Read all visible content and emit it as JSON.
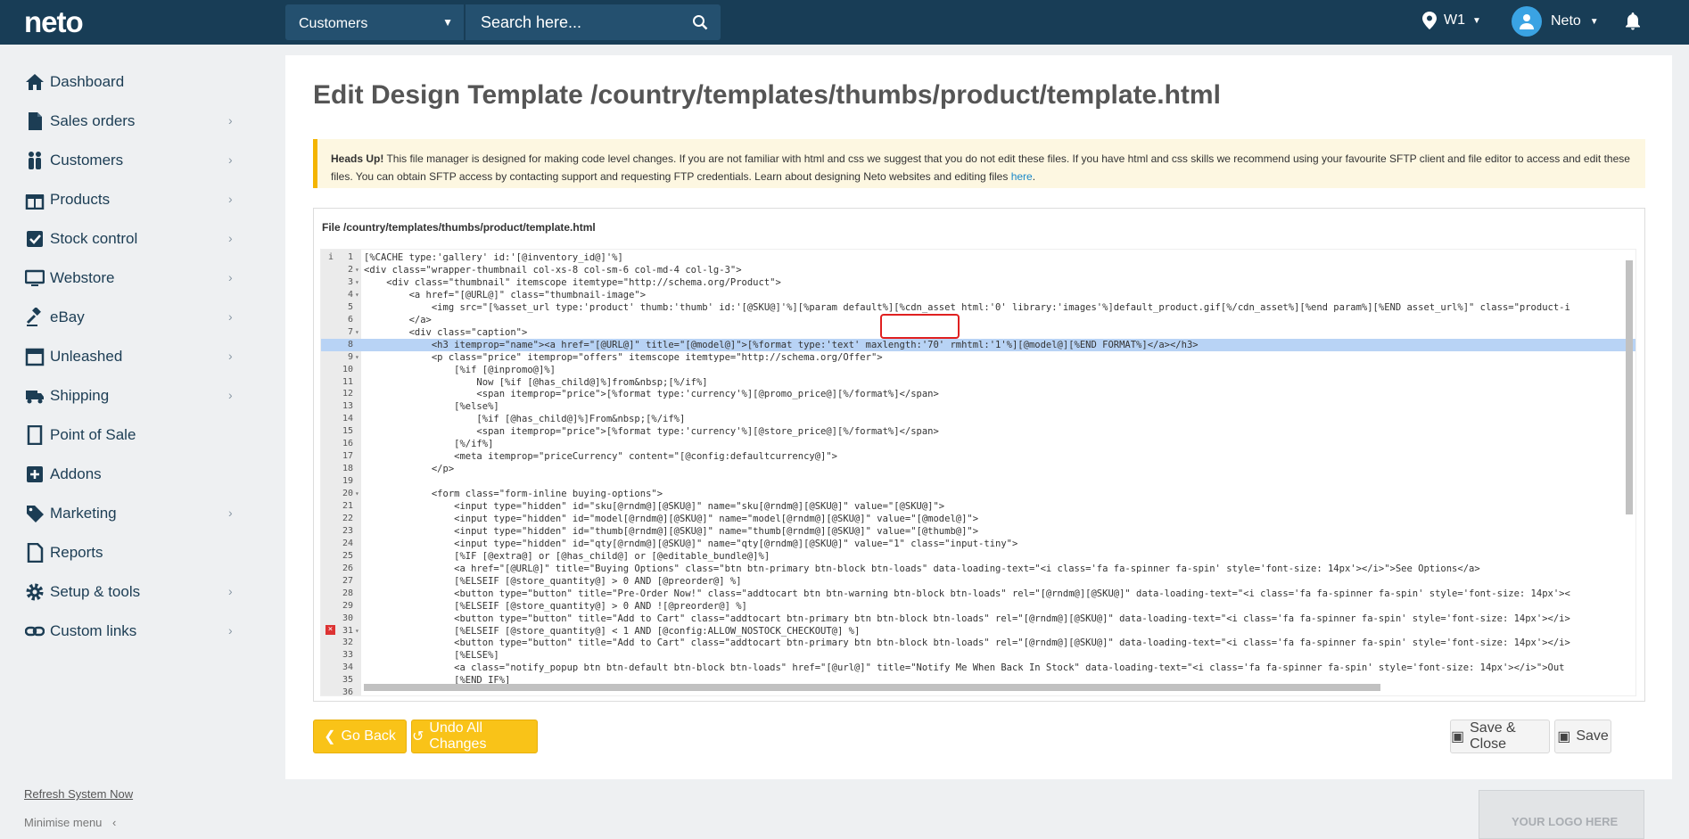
{
  "topbar": {
    "logo": "neto",
    "scope": "Customers",
    "search_placeholder": "Search here...",
    "location": "W1",
    "user": "Neto"
  },
  "sidebar": {
    "items": [
      {
        "label": "Dashboard",
        "icon": "home-icon"
      },
      {
        "label": "Sales orders",
        "icon": "document-icon"
      },
      {
        "label": "Customers",
        "icon": "people-icon"
      },
      {
        "label": "Products",
        "icon": "gift-icon"
      },
      {
        "label": "Stock control",
        "icon": "checkbox-icon"
      },
      {
        "label": "Webstore",
        "icon": "monitor-icon"
      },
      {
        "label": "eBay",
        "icon": "gavel-icon"
      },
      {
        "label": "Unleashed",
        "icon": "box-icon"
      },
      {
        "label": "Shipping",
        "icon": "truck-icon"
      },
      {
        "label": "Point of Sale",
        "icon": "pos-icon"
      },
      {
        "label": "Addons",
        "icon": "plus-box-icon"
      },
      {
        "label": "Marketing",
        "icon": "tag-icon"
      },
      {
        "label": "Reports",
        "icon": "report-icon"
      },
      {
        "label": "Setup & tools",
        "icon": "gear-icon"
      },
      {
        "label": "Custom links",
        "icon": "link-icon"
      }
    ],
    "refresh": "Refresh System Now",
    "minimise": "Minimise menu"
  },
  "main": {
    "title": "Edit Design Template /country/templates/thumbs/product/template.html",
    "alert": {
      "heading": "Heads Up!",
      "text": " This file manager is designed for making code level changes. If you are not familiar with html and css we suggest that you do not edit these files. If you have html and css skills we recommend using your favourite SFTP client and file editor to access and edit these files. You can obtain SFTP access by contacting support and requesting FTP credentials. Learn about designing Neto websites and editing files ",
      "link": "here",
      "end": "."
    },
    "file_label": "File /country/templates/thumbs/product/template.html",
    "code_lines": [
      {
        "n": "1",
        "text": "[%CACHE type:'gallery' id:'[@inventory_id@]'%]"
      },
      {
        "n": "2",
        "text": "<div class=\"wrapper-thumbnail col-xs-8 col-sm-6 col-md-4 col-lg-3\">"
      },
      {
        "n": "3",
        "text": "    <div class=\"thumbnail\" itemscope itemtype=\"http://schema.org/Product\">"
      },
      {
        "n": "4",
        "text": "        <a href=\"[@URL@]\" class=\"thumbnail-image\">"
      },
      {
        "n": "5",
        "text": "            <img src=\"[%asset_url type:'product' thumb:'thumb' id:'[@SKU@]'%][%param default%][%cdn_asset html:'0' library:'images'%]default_product.gif[%/cdn_asset%][%end param%][%END asset_url%]\" class=\"product-i"
      },
      {
        "n": "6",
        "text": "        </a>"
      },
      {
        "n": "7",
        "text": "        <div class=\"caption\">"
      },
      {
        "n": "8",
        "text": "            <h3 itemprop=\"name\"><a href=\"[@URL@]\" title=\"[@model@]\">[%format type:'text' maxlength:'70' rmhtml:'1'%][@model@][%END FORMAT%]</a></h3>"
      },
      {
        "n": "9",
        "text": "            <p class=\"price\" itemprop=\"offers\" itemscope itemtype=\"http://schema.org/Offer\">"
      },
      {
        "n": "10",
        "text": "                [%if [@inpromo@]%]"
      },
      {
        "n": "11",
        "text": "                    Now [%if [@has_child@]%]from&nbsp;[%/if%]"
      },
      {
        "n": "12",
        "text": "                    <span itemprop=\"price\">[%format type:'currency'%][@promo_price@][%/format%]</span>"
      },
      {
        "n": "13",
        "text": "                [%else%]"
      },
      {
        "n": "14",
        "text": "                    [%if [@has_child@]%]From&nbsp;[%/if%]"
      },
      {
        "n": "15",
        "text": "                    <span itemprop=\"price\">[%format type:'currency'%][@store_price@][%/format%]</span>"
      },
      {
        "n": "16",
        "text": "                [%/if%]"
      },
      {
        "n": "17",
        "text": "                <meta itemprop=\"priceCurrency\" content=\"[@config:defaultcurrency@]\">"
      },
      {
        "n": "18",
        "text": "            </p>"
      },
      {
        "n": "19",
        "text": ""
      },
      {
        "n": "20",
        "text": "            <form class=\"form-inline buying-options\">"
      },
      {
        "n": "21",
        "text": "                <input type=\"hidden\" id=\"sku[@rndm@][@SKU@]\" name=\"sku[@rndm@][@SKU@]\" value=\"[@SKU@]\">"
      },
      {
        "n": "22",
        "text": "                <input type=\"hidden\" id=\"model[@rndm@][@SKU@]\" name=\"model[@rndm@][@SKU@]\" value=\"[@model@]\">"
      },
      {
        "n": "23",
        "text": "                <input type=\"hidden\" id=\"thumb[@rndm@][@SKU@]\" name=\"thumb[@rndm@][@SKU@]\" value=\"[@thumb@]\">"
      },
      {
        "n": "24",
        "text": "                <input type=\"hidden\" id=\"qty[@rndm@][@SKU@]\" name=\"qty[@rndm@][@SKU@]\" value=\"1\" class=\"input-tiny\">"
      },
      {
        "n": "25",
        "text": "                [%IF [@extra@] or [@has_child@] or [@editable_bundle@]%]"
      },
      {
        "n": "26",
        "text": "                <a href=\"[@URL@]\" title=\"Buying Options\" class=\"btn btn-primary btn-block btn-loads\" data-loading-text=\"<i class='fa fa-spinner fa-spin' style='font-size: 14px'></i>\">See Options</a>"
      },
      {
        "n": "27",
        "text": "                [%ELSEIF [@store_quantity@] > 0 AND [@preorder@] %]"
      },
      {
        "n": "28",
        "text": "                <button type=\"button\" title=\"Pre-Order Now!\" class=\"addtocart btn btn-warning btn-block btn-loads\" rel=\"[@rndm@][@SKU@]\" data-loading-text=\"<i class='fa fa-spinner fa-spin' style='font-size: 14px'><"
      },
      {
        "n": "29",
        "text": "                [%ELSEIF [@store_quantity@] > 0 AND ![@preorder@] %]"
      },
      {
        "n": "30",
        "text": "                <button type=\"button\" title=\"Add to Cart\" class=\"addtocart btn-primary btn btn-block btn-loads\" rel=\"[@rndm@][@SKU@]\" data-loading-text=\"<i class='fa fa-spinner fa-spin' style='font-size: 14px'></i>"
      },
      {
        "n": "31",
        "text": "                [%ELSEIF [@store_quantity@] < 1 AND [@config:ALLOW_NOSTOCK_CHECKOUT@] %]"
      },
      {
        "n": "32",
        "text": "                <button type=\"button\" title=\"Add to Cart\" class=\"addtocart btn-primary btn btn-block btn-loads\" rel=\"[@rndm@][@SKU@]\" data-loading-text=\"<i class='fa fa-spinner fa-spin' style='font-size: 14px'></i>"
      },
      {
        "n": "33",
        "text": "                [%ELSE%]"
      },
      {
        "n": "34",
        "text": "                <a class=\"notify_popup btn btn-default btn-block btn-loads\" href=\"[@url@]\" title=\"Notify Me When Back In Stock\" data-loading-text=\"<i class='fa fa-spinner fa-spin' style='font-size: 14px'></i>\">Out"
      },
      {
        "n": "35",
        "text": "                [%END IF%]"
      },
      {
        "n": "36",
        "text": ""
      }
    ],
    "buttons": {
      "go_back": "Go Back",
      "undo": "Undo All Changes",
      "save_close": "Save & Close",
      "save": "Save"
    },
    "logo_placeholder": "YOUR LOGO HERE"
  },
  "colors": {
    "topbar": "#183d56",
    "accent": "#f9c318",
    "active_line": "#b8d3f5",
    "highlight": "#e02020"
  }
}
